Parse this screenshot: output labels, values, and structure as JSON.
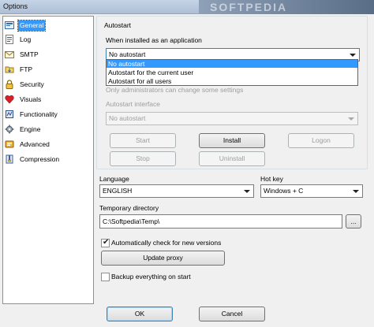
{
  "window": {
    "title": "Options",
    "watermark": "SOFTPEDIA"
  },
  "sidebar": {
    "items": [
      {
        "label": "General",
        "icon": "general-icon"
      },
      {
        "label": "Log",
        "icon": "log-icon"
      },
      {
        "label": "SMTP",
        "icon": "smtp-icon"
      },
      {
        "label": "FTP",
        "icon": "ftp-icon"
      },
      {
        "label": "Security",
        "icon": "lock-icon"
      },
      {
        "label": "Visuals",
        "icon": "heart-icon"
      },
      {
        "label": "Functionality",
        "icon": "functionality-icon"
      },
      {
        "label": "Engine",
        "icon": "gear-icon"
      },
      {
        "label": "Advanced",
        "icon": "advanced-icon"
      },
      {
        "label": "Compression",
        "icon": "compression-icon"
      }
    ],
    "selected": "General"
  },
  "autostart": {
    "group_title": "Autostart",
    "when_installed_label": "When installed as an application",
    "autostart_selected": "No autostart",
    "autostart_options": [
      "No autostart",
      "Autostart for the current user",
      "Autostart for all users"
    ],
    "note_text": "Only administrators can change some settings",
    "interface_label": "Autostart interface",
    "interface_selected": "No autostart",
    "buttons": {
      "start": "Start",
      "install": "Install",
      "logon": "Logon",
      "stop": "Stop",
      "uninstall": "Uninstall"
    }
  },
  "language": {
    "label": "Language",
    "selected": "ENGLISH"
  },
  "hotkey": {
    "label": "Hot key",
    "selected": "Windows + C"
  },
  "temp_dir": {
    "label": "Temporary directory",
    "value": "C:\\Softpedia\\Temp\\",
    "browse_label": "..."
  },
  "check_versions": {
    "label": "Automatically check for new versions",
    "checked": true
  },
  "update_proxy_label": "Update proxy",
  "backup": {
    "label": "Backup everything on start",
    "checked": false
  },
  "footer": {
    "ok_label": "OK",
    "cancel_label": "Cancel"
  },
  "colors": {
    "selection": "#3399ff",
    "window_bg": "#f0f0f0",
    "disabled_text": "#9d9d9d"
  }
}
